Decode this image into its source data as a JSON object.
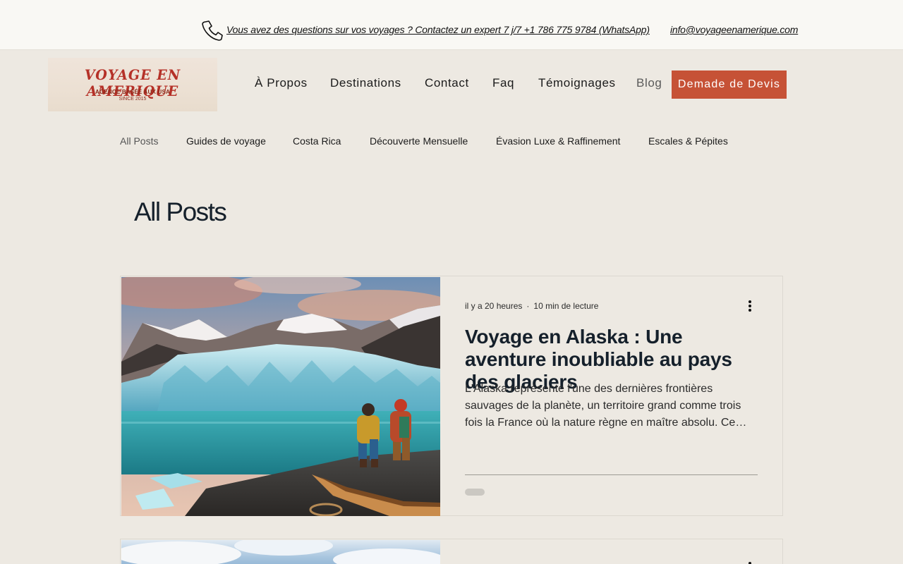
{
  "topbar": {
    "contact_text": "Vous avez des questions sur vos voyages ? Contactez un expert 7 j/7 +1 786 775 9784 (WhatsApp)",
    "email": "info@voyageenamerique.com",
    "phone_icon": "phone-icon"
  },
  "logo": {
    "title": "VOYAGE EN AMERIQUE",
    "subtitle": "AGENCE BASÉE AUX USA",
    "since": "SINCE 2015"
  },
  "nav": {
    "items": [
      "À Propos",
      "Destinations",
      "Contact",
      "Faq",
      "Témoignages",
      "Blog"
    ],
    "cta": "Demade de Devis"
  },
  "categories": [
    "All Posts",
    "Guides de voyage",
    "Costa Rica",
    "Découverte Mensuelle",
    "Évasion Luxe & Raffinement",
    "Escales & Pépites"
  ],
  "page_title": "All Posts",
  "posts": [
    {
      "time_ago": "il y a 20 heures",
      "read_time": "10 min de lecture",
      "title": "Voyage en Alaska : Une aventure inoubliable au pays des glaciers",
      "excerpt": "L'Alaska représente l'une des dernières frontières sauvages de la planète, un territoire grand comme trois fois la France où la nature règne en maître absolu. Ce…",
      "more_icon": "more-vert-icon"
    }
  ],
  "colors": {
    "background": "#ede9e2",
    "cta": "#c65236",
    "topbar": "#f9f8f4",
    "title": "#15202b"
  }
}
